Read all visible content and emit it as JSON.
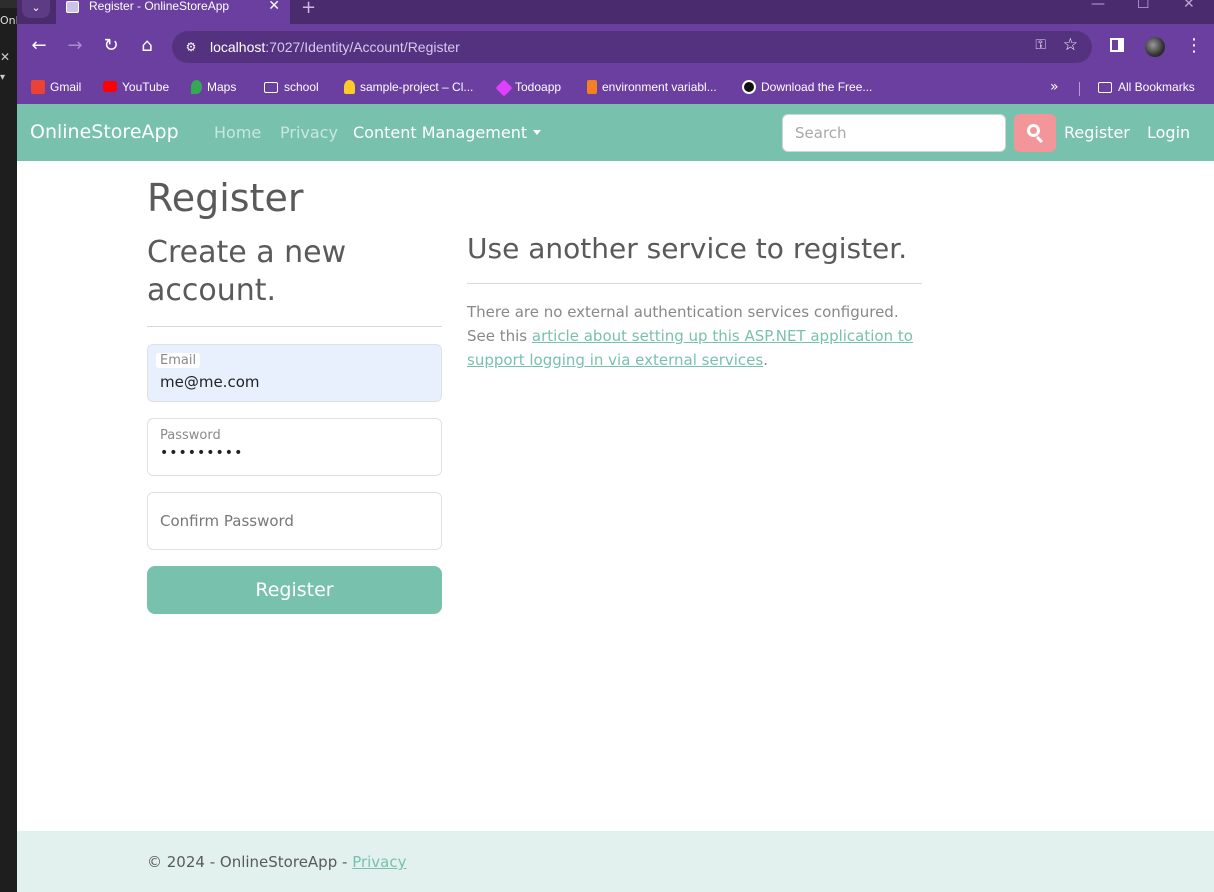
{
  "browser": {
    "tab_title": "Register - OnlineStoreApp",
    "url_host": "localhost",
    "url_path": ":7027/Identity/Account/Register",
    "bookmarks": [
      {
        "label": "Gmail",
        "icon": "gmail-icon",
        "color": "#ea4335"
      },
      {
        "label": "YouTube",
        "icon": "youtube-icon",
        "color": "#ff0000"
      },
      {
        "label": "Maps",
        "icon": "maps-icon",
        "color": "#34a853"
      },
      {
        "label": "school",
        "icon": "folder-icon"
      },
      {
        "label": "sample-project – Cl...",
        "icon": "firebase-icon",
        "color": "#ffca28"
      },
      {
        "label": "Todoapp",
        "icon": "todoapp-icon",
        "color": "#e040fb"
      },
      {
        "label": "environment variabl...",
        "icon": "stackoverflow-icon",
        "color": "#f48024"
      },
      {
        "label": "Download the Free...",
        "icon": "eye-icon",
        "color": "#111111"
      }
    ],
    "all_bookmarks": "All Bookmarks"
  },
  "navbar": {
    "brand": "OnlineStoreApp",
    "home": "Home",
    "privacy": "Privacy",
    "content_management": "Content Management",
    "search_placeholder": "Search",
    "register": "Register",
    "login": "Login",
    "accent_color": "#78c2ad",
    "search_button_color": "#f3969a"
  },
  "page": {
    "title": "Register",
    "subtitle": "Create a new account.",
    "email_label": "Email",
    "email_value": "me@me.com",
    "password_label": "Password",
    "password_value": "•••••••••",
    "confirm_placeholder": "Confirm Password",
    "register_button": "Register",
    "external_heading": "Use another service to register.",
    "external_text_1": "There are no external authentication services configured. See this",
    "external_link": "article about setting up this ASP.NET application to support logging in via external services",
    "external_text_2": "."
  },
  "footer": {
    "copyright": "© 2024 - OnlineStoreApp -",
    "privacy_link": "Privacy"
  }
}
